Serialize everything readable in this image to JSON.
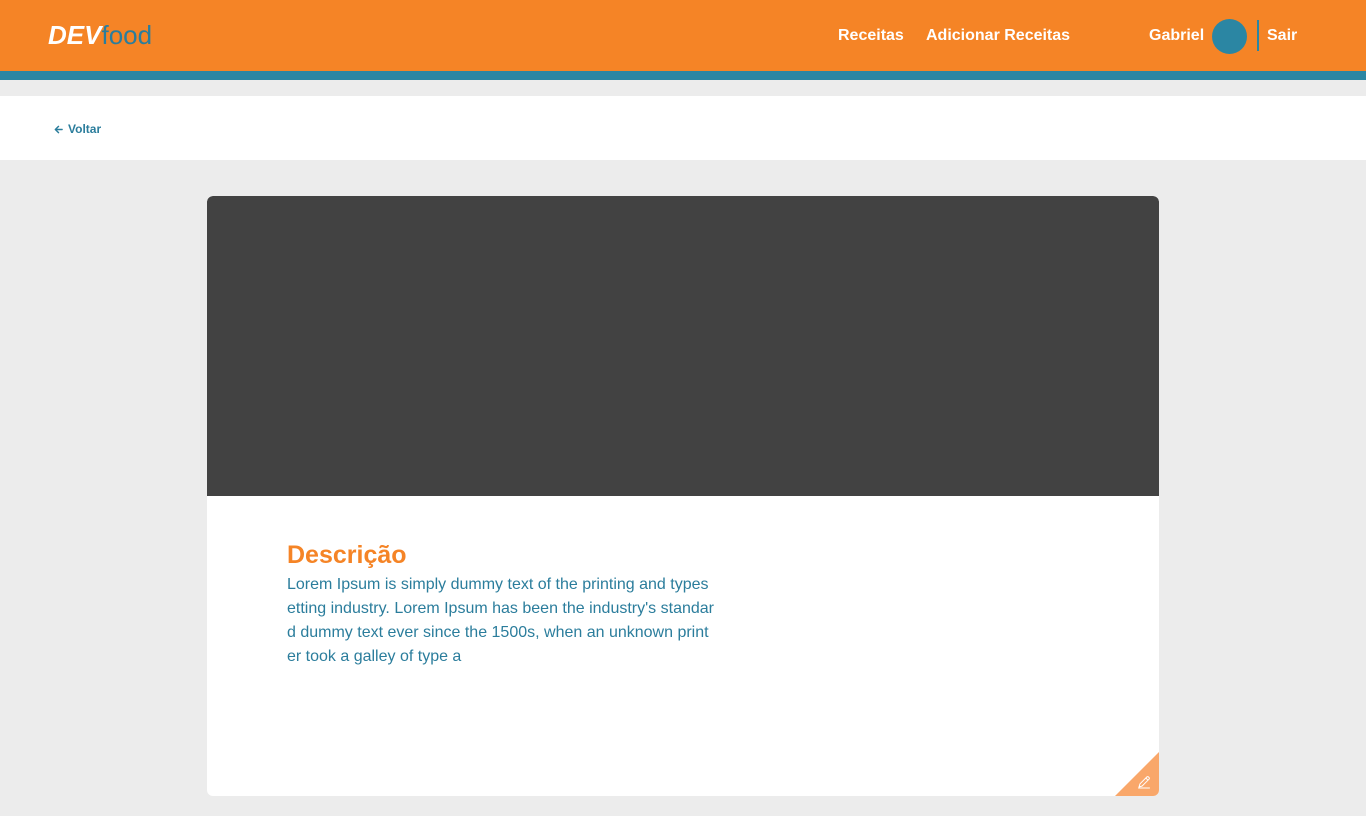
{
  "header": {
    "logo_bold": "DEV",
    "logo_light": "food",
    "nav": {
      "recipes": "Receitas",
      "add_recipe": "Adicionar Receitas"
    },
    "user": {
      "name": "Gabriel"
    },
    "logout": "Sair"
  },
  "subbar": {
    "back_label": "Voltar"
  },
  "recipe": {
    "description_title": "Descrição",
    "description_text": "Lorem Ipsum is simply dummy text of the printing and typesetting industry. Lorem Ipsum has been the industry's standard dummy text ever since the 1500s, when an unknown printer took a galley of type a"
  },
  "icons": {
    "back": "arrow-left-icon",
    "edit": "pencil-icon"
  },
  "colors": {
    "primary": "#f58426",
    "secondary": "#2b86a3",
    "text_accent": "#2b7d9c",
    "image_placeholder": "#424242",
    "background": "#ececec",
    "edit_corner": "#f9a76a"
  }
}
